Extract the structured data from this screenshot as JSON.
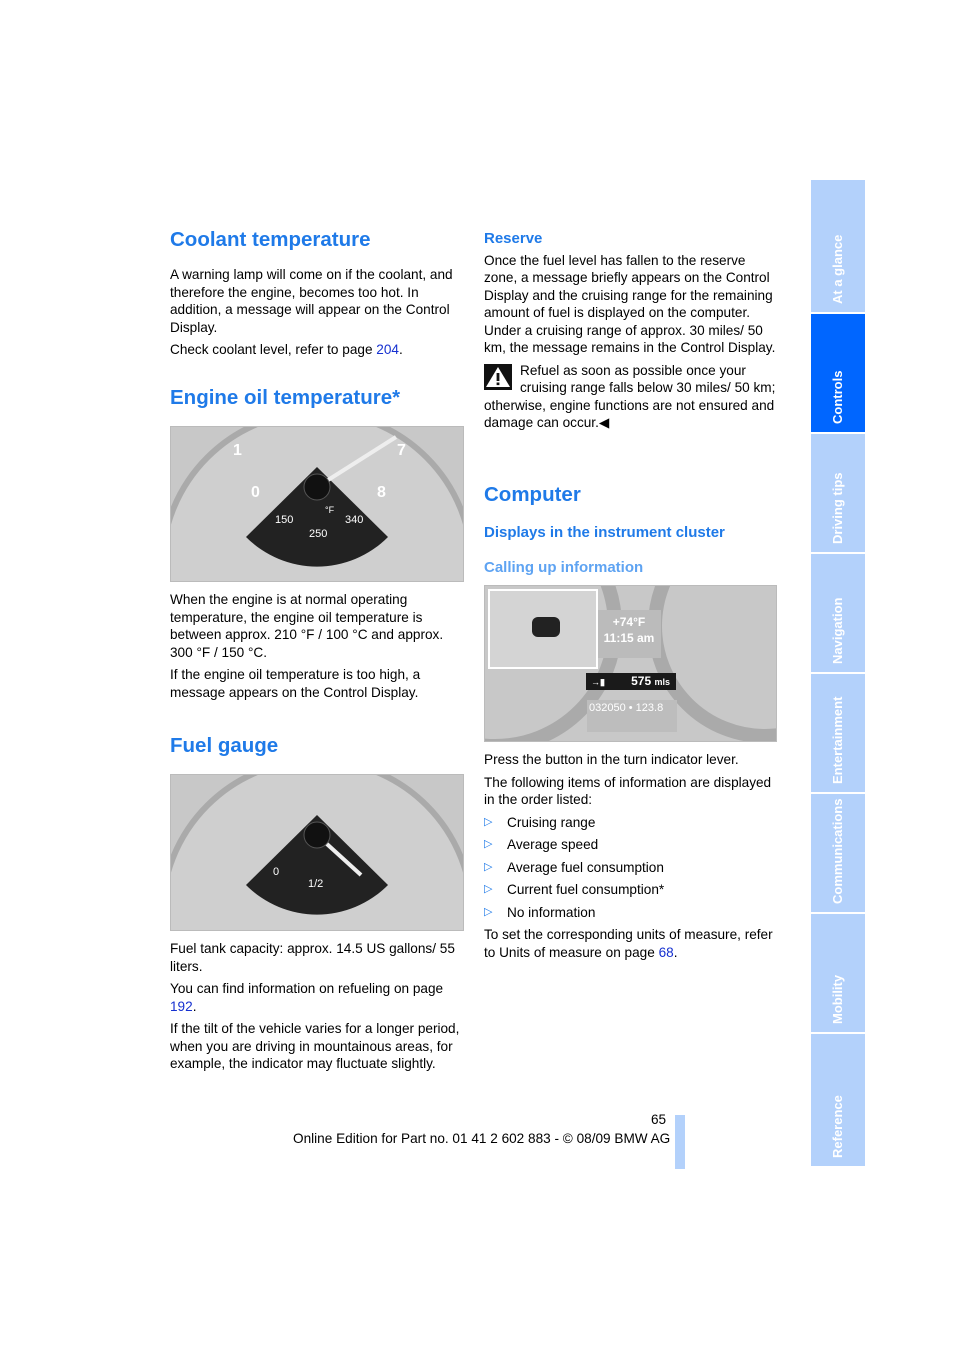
{
  "left": {
    "coolant": {
      "title": "Coolant temperature",
      "p1": "A warning lamp will come on if the coolant, and therefore the engine, becomes too hot. In addition, a message will appear on the Control Display.",
      "p2_pre": "Check coolant level, refer to page ",
      "p2_link": "204",
      "p2_post": "."
    },
    "oil": {
      "title": "Engine oil temperature*",
      "gauge_labels": [
        "1",
        "7",
        "0",
        "8",
        "150",
        "°F",
        "250",
        "340"
      ],
      "p1": "When the engine is at normal operating temperature, the engine oil temperature is between approx. 210 °F / 100 °C and approx. 300 °F / 150 °C.",
      "p2": "If the engine oil temperature is too high, a message appears on the Control Display."
    },
    "fuel": {
      "title": "Fuel gauge",
      "gauge_labels": [
        "0",
        "1/2"
      ],
      "p1": "Fuel tank capacity: approx. 14.5 US gallons/ 55 liters.",
      "p2_pre": "You can find information on refueling on page ",
      "p2_link": "192",
      "p2_post": ".",
      "p3": "If the tilt of the vehicle varies for a longer period, when you are driving in mountainous areas, for example, the indicator may fluctuate slightly."
    }
  },
  "right": {
    "reserve": {
      "title": "Reserve",
      "p1": "Once the fuel level has fallen to the reserve zone, a message briefly appears on the Control Display and the cruising range for the remaining amount of fuel is displayed on the computer. Under a cruising range of approx. 30 miles/ 50 km, the message remains in the Control Display.",
      "warning": "Refuel as soon as possible once your cruising range falls below 30 miles/ 50 km; otherwise, engine functions are not ensured and damage can occur.◀",
      "warning_icon": "warning-triangle-icon"
    },
    "computer": {
      "title": "Computer",
      "subtitle": "Displays in the instrument cluster",
      "subsubtitle": "Calling up information",
      "display": {
        "temp": "+74°F",
        "time": "11:15 am",
        "range": "575",
        "range_unit": "mls",
        "odometer": "032050 • 123.8"
      },
      "p1": "Press the button in the turn indicator lever.",
      "p2": "The following items of information are displayed in the order listed:",
      "items": [
        "Cruising range",
        "Average speed",
        "Average fuel consumption",
        "Current fuel consumption*",
        "No information"
      ],
      "p3_pre": "To set the corresponding units of measure, refer to Units of measure on page ",
      "p3_link": "68",
      "p3_post": "."
    }
  },
  "footer": {
    "page": "65",
    "edition": "Online Edition for Part no. 01 41 2 602 883 - © 08/09 BMW AG"
  },
  "tabs": [
    {
      "label": "At a glance"
    },
    {
      "label": "Controls",
      "active": true
    },
    {
      "label": "Driving tips"
    },
    {
      "label": "Navigation"
    },
    {
      "label": "Entertainment"
    },
    {
      "label": "Communications"
    },
    {
      "label": "Mobility"
    },
    {
      "label": "Reference"
    }
  ],
  "colors": {
    "heading": "#1f7ae8",
    "tab": "#b3d1fb",
    "tab_active": "#0066ff"
  }
}
